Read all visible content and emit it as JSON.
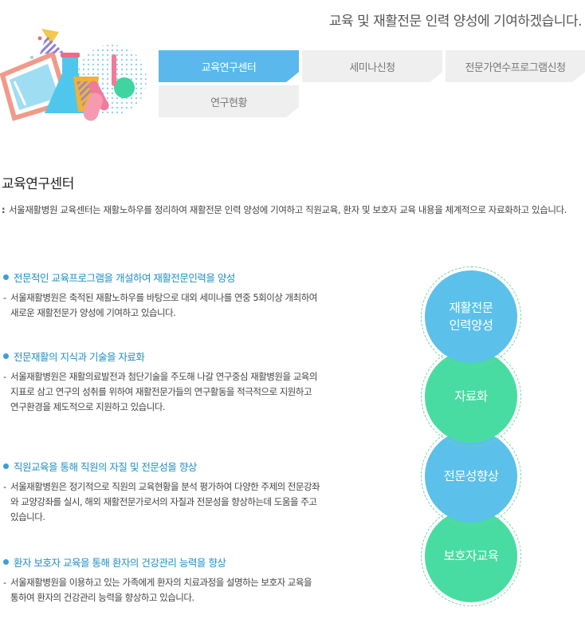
{
  "header": {
    "slogan": "교육 및 재활전문 인력 양성에 기여하겠습니다."
  },
  "tabs": [
    {
      "label": "교육연구센터",
      "active": true
    },
    {
      "label": "세미나신청",
      "active": false
    },
    {
      "label": "전문가연수프로그램신청",
      "active": false
    },
    {
      "label": "연구현황",
      "active": false
    }
  ],
  "section": {
    "title": "교육연구센터",
    "intro_colon": ":",
    "intro": "서울재활병원 교육센터는 재활노하우를 정리하여 재활전문 인력 양성에 기여하고 직원교육, 환자 및 보호자 교육 내용을 체계적으로 자료화하고 있습니다."
  },
  "items": [
    {
      "title": "전문적인 교육프로그램을 개설하여 재활전문인력을 양성",
      "dash": "-",
      "desc": "서울재활병원은 축적된 재활노하우를 바탕으로 대외 세미나를 연중 5회이상 개최하여 새로운 재활전문가 양성에 기여하고 있습니다."
    },
    {
      "title": "전문재활의 지식과 기술을 자료화",
      "dash": "-",
      "desc": "서울재활병원은 재활의료발전과 첨단기술을 주도해 나갈 연구중심 재활병원을 교육의 지표로 삼고 연구의 성취를 위하여 재활전문가들의 연구활동을 적극적으로 지원하고 연구환경을 제도적으로 지원하고 있습니다."
    },
    {
      "title": "직원교육을 통해 직원의 자질 및 전문성을 향상",
      "dash": "-",
      "desc": "서울재활병원은 정기적으로 직원의 교육현황을 분석 평가하여 다양한 주제의 전문강좌와 교양강좌를 실시, 해외 재활전문가로서의 자질과 전문성을 향상하는데 도움을 주고 있습니다."
    },
    {
      "title": "환자 보호자 교육을 통해 환자의 건강관리 능력을 향상",
      "dash": "-",
      "desc": "서울재활병원을 이용하고 있는 가족에게 환자의 치료과정을 설명하는 보호자 교육을 통하여 환자의 건강관리 능력을 향상하고 있습니다."
    }
  ],
  "circles": [
    {
      "label": "재활전문\n인력양성",
      "color": "#5bc0ea"
    },
    {
      "label": "자료화",
      "color": "#48dca2"
    },
    {
      "label": "전문성향상",
      "color": "#5bc0ea"
    },
    {
      "label": "보호자교육",
      "color": "#48dca2"
    }
  ]
}
